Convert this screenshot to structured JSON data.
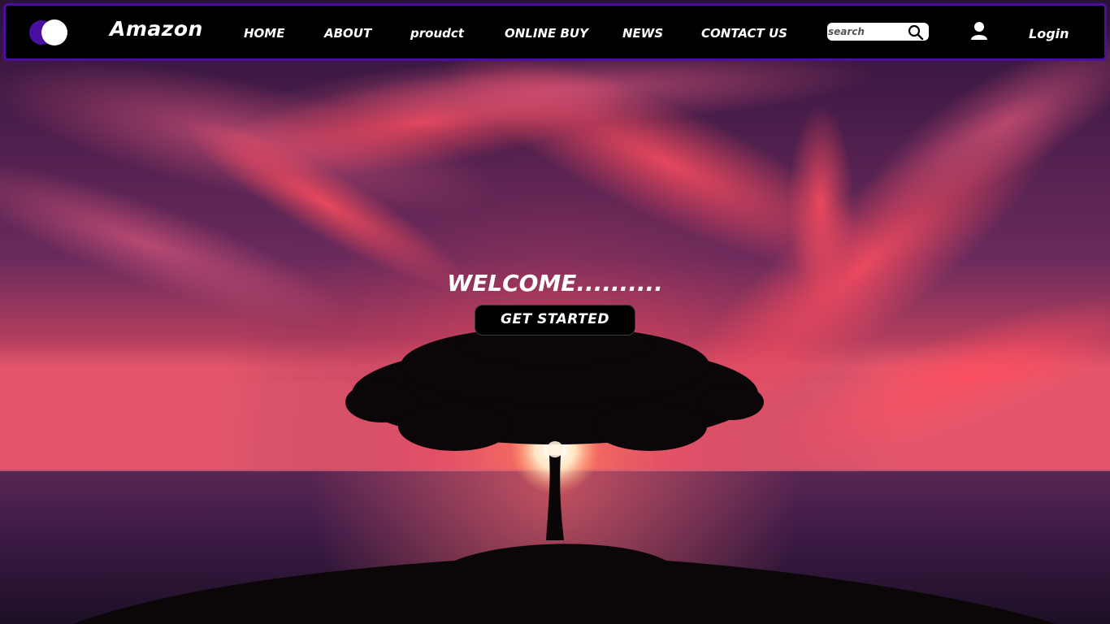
{
  "navbar": {
    "brand": "Amazon",
    "links": [
      {
        "label": "HOME"
      },
      {
        "label": "ABOUT"
      },
      {
        "label": "proudct"
      },
      {
        "label": "ONLINE BUY"
      },
      {
        "label": "NEWS"
      },
      {
        "label": "CONTACT US"
      }
    ],
    "search": {
      "placeholder": "search",
      "value": ""
    },
    "login_label": "Login",
    "border_color": "#4b0fa0",
    "toggle_colors": [
      "#4b0fa0",
      "#ffffff"
    ]
  },
  "hero": {
    "welcome": "WELCOME..........",
    "cta_label": "GET STARTED",
    "background": "sunset-tree-sea-image"
  },
  "icons": {
    "search": "magnifier-icon",
    "user": "user-icon",
    "theme_toggle": "toggle-icon"
  }
}
